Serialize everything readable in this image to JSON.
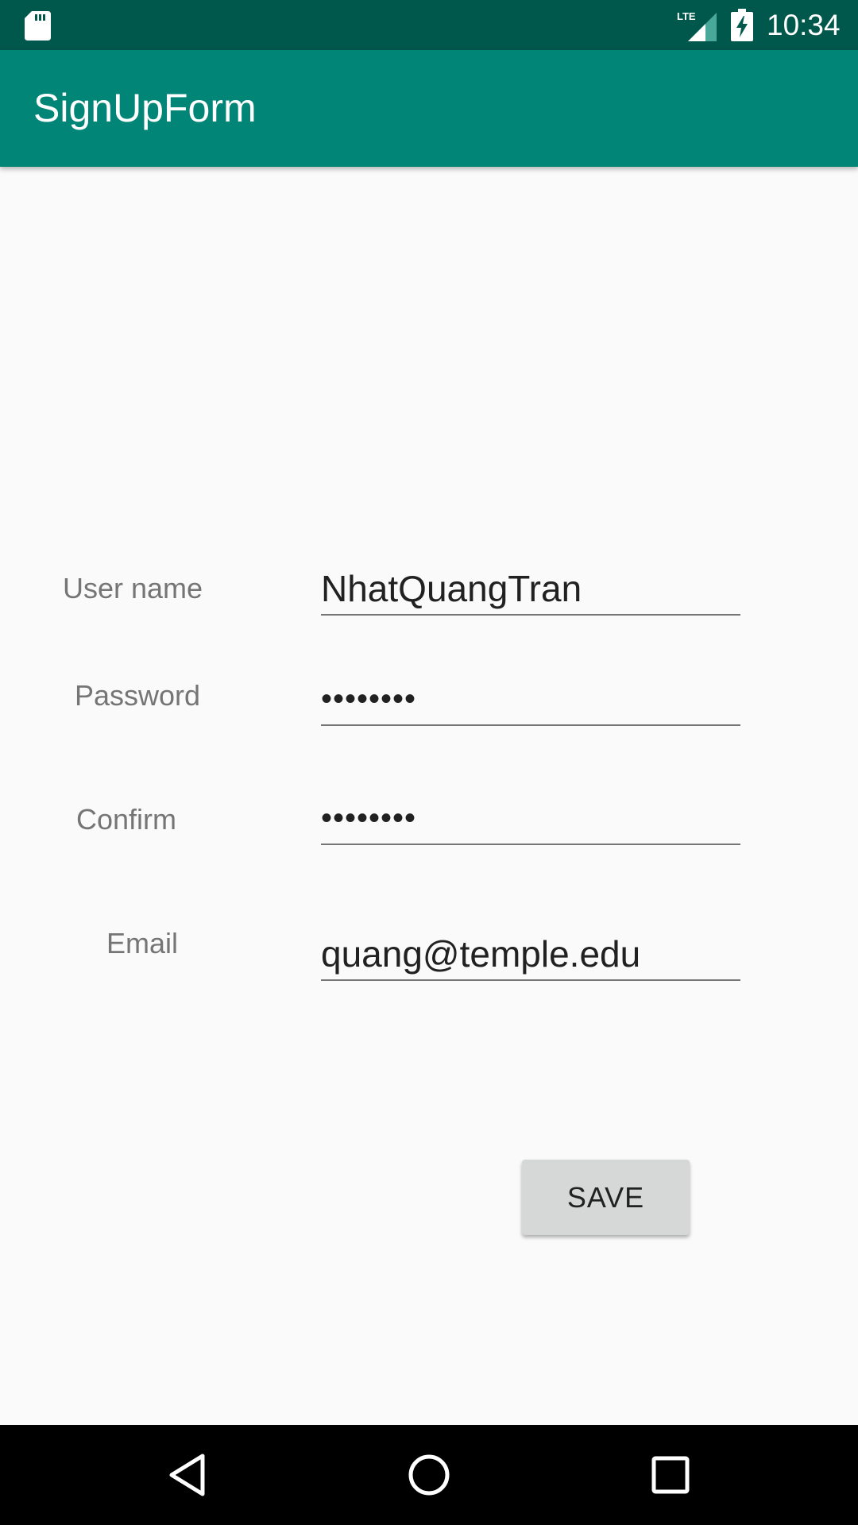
{
  "status_bar": {
    "time": "10:34",
    "network": "LTE",
    "icons": [
      "sd-card-icon",
      "lte-signal-icon",
      "battery-charging-icon"
    ]
  },
  "app_bar": {
    "title": "SignUpForm"
  },
  "form": {
    "username": {
      "label": "User name",
      "value": "NhatQuangTran"
    },
    "password": {
      "label": "Password",
      "value": "••••••••"
    },
    "confirm": {
      "label": "Confirm",
      "value": "••••••••"
    },
    "email": {
      "label": "Email",
      "value": "quang@temple.edu"
    },
    "save_label": "SAVE"
  },
  "nav_bar": {
    "icons": [
      "back-icon",
      "home-icon",
      "recents-icon"
    ]
  },
  "colors": {
    "status_bar": "#00574b",
    "app_bar": "#008577",
    "background": "#fafafa",
    "button": "#d6d7d7"
  }
}
